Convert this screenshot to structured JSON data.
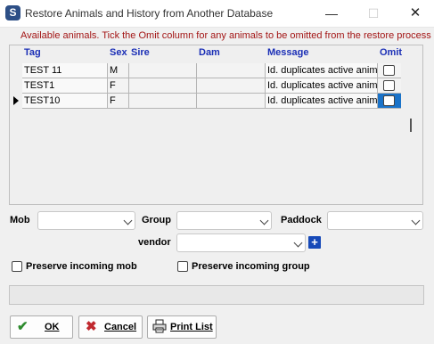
{
  "window": {
    "title": "Restore Animals and History from Another Database",
    "min_glyph": "—",
    "max_glyph": "☐",
    "close_glyph": "✕"
  },
  "instruction": "Available animals. Tick the Omit column for any animals to be omitted from the restore process",
  "grid": {
    "columns": [
      "Tag",
      "Sex",
      "Sire",
      "Dam",
      "Message",
      "Omit"
    ],
    "rows": [
      {
        "tag": "TEST 11",
        "sex": "M",
        "sire": "",
        "dam": "",
        "message": "Id. duplicates active animal",
        "omit": false,
        "current": false
      },
      {
        "tag": "TEST1",
        "sex": "F",
        "sire": "",
        "dam": "",
        "message": "Id. duplicates active animal",
        "omit": false,
        "current": false
      },
      {
        "tag": "TEST10",
        "sex": "F",
        "sire": "",
        "dam": "",
        "message": "Id. duplicates active animal",
        "omit": false,
        "current": true
      }
    ]
  },
  "filters": {
    "mob_label": "Mob",
    "group_label": "Group",
    "paddock_label": "Paddock",
    "vendor_label": "vendor",
    "mob_value": "",
    "group_value": "",
    "paddock_value": "",
    "vendor_value": "",
    "add_vendor_glyph": "+"
  },
  "options": {
    "preserve_mob_label": "Preserve incoming mob",
    "preserve_mob_checked": false,
    "preserve_group_label": "Preserve incoming  group",
    "preserve_group_checked": false
  },
  "progress": {
    "value": 0
  },
  "buttons": {
    "ok_label": "OK",
    "cancel_label": "Cancel",
    "print_label": "Print List"
  },
  "icons": {
    "app": "app-logo-icon",
    "ok": "checkmark-icon",
    "cancel": "x-icon",
    "print": "printer-icon"
  },
  "colors": {
    "instruction_text": "#a31515",
    "column_header": "#1b2fb6",
    "selected_cell": "#1a73c9",
    "ok_icon": "#2e8b2e",
    "cancel_icon": "#c0282e",
    "plus_button": "#1649b8"
  }
}
